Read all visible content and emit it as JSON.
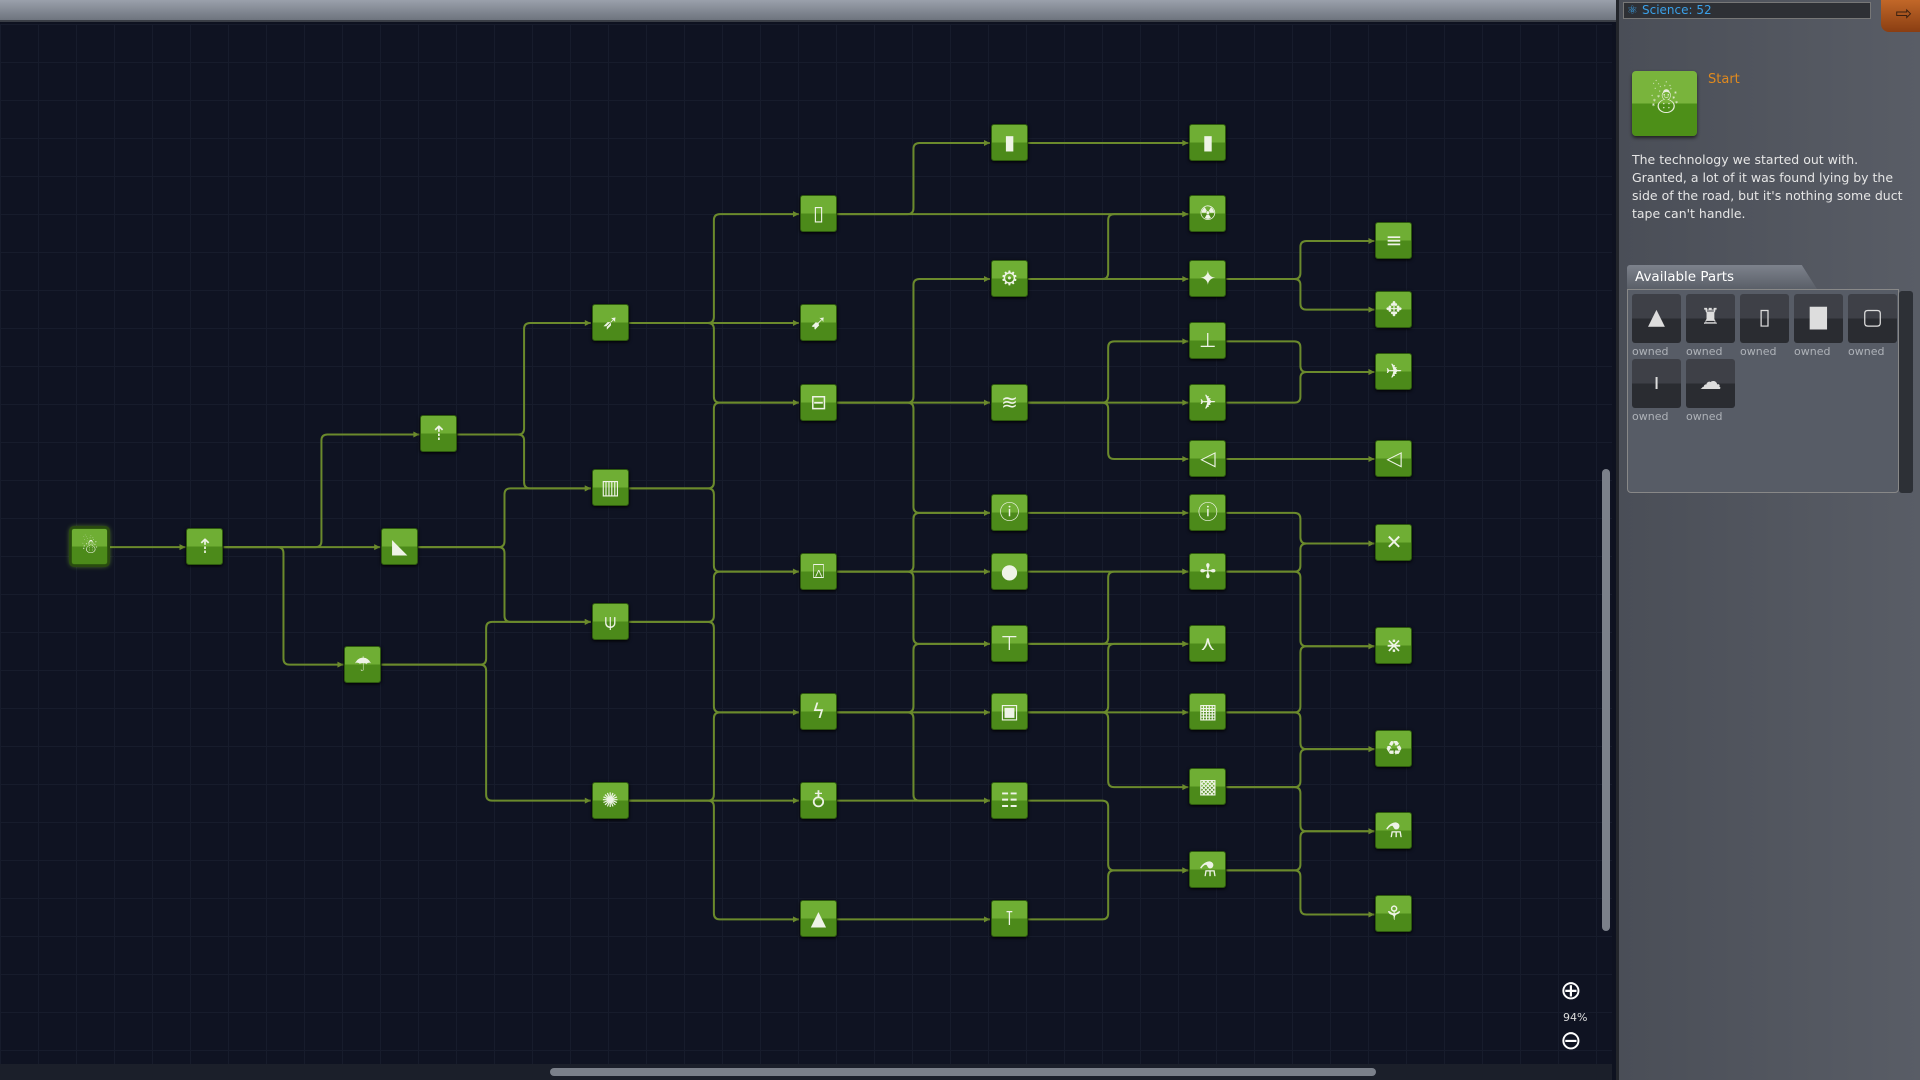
{
  "science": {
    "label": "Science: 52",
    "icon": "atom-icon"
  },
  "exit_button": {
    "icon": "exit-icon"
  },
  "selected_tech": {
    "title": "Start",
    "icon": "kerbal-icon",
    "description": "The technology we started out with. Granted, a lot of it was found lying by the side of the road, but it's nothing some duct tape can't handle."
  },
  "available_parts": {
    "tab_label": "Available Parts",
    "items": [
      {
        "icon": "command-pod-icon",
        "status": "owned"
      },
      {
        "icon": "liquid-engine-icon",
        "status": "owned"
      },
      {
        "icon": "fuel-tank-small-icon",
        "status": "owned"
      },
      {
        "icon": "fuel-tank-icon",
        "status": "owned"
      },
      {
        "icon": "truss-icon",
        "status": "owned"
      },
      {
        "icon": "solid-booster-icon",
        "status": "owned"
      },
      {
        "icon": "parachute-part-icon",
        "status": "owned"
      }
    ]
  },
  "zoom": {
    "level": "94%",
    "in_icon": "zoom-in-icon",
    "out_icon": "zoom-out-icon"
  },
  "colors": {
    "node": "#5c9c28",
    "edge": "#6b8a2c",
    "accent": "#e08a1e",
    "science": "#3aa0e8"
  },
  "nodes": [
    {
      "id": "start",
      "icon": "kerbal-icon",
      "selected": true
    },
    {
      "id": "n2",
      "icon": "rocket-icon"
    },
    {
      "id": "n3a",
      "icon": "rocket-icon"
    },
    {
      "id": "n3b",
      "icon": "wing-icon"
    },
    {
      "id": "n3c",
      "icon": "parachute-icon"
    },
    {
      "id": "n4a",
      "icon": "engine-icon"
    },
    {
      "id": "n4b",
      "icon": "tower-icon"
    },
    {
      "id": "n4c",
      "icon": "antenna-icon"
    },
    {
      "id": "n4d",
      "icon": "lightbulb-icon"
    },
    {
      "id": "n5a",
      "icon": "tank-icon"
    },
    {
      "id": "n5b",
      "icon": "jet-icon"
    },
    {
      "id": "n5c",
      "icon": "decoupler-icon"
    },
    {
      "id": "n5d",
      "icon": "dish-icon"
    },
    {
      "id": "n5e",
      "icon": "lightning-icon"
    },
    {
      "id": "n5f",
      "icon": "probe-icon"
    },
    {
      "id": "n5g",
      "icon": "lander-icon"
    },
    {
      "id": "n6a",
      "icon": "tanks-icon"
    },
    {
      "id": "n6b",
      "icon": "gear-icon"
    },
    {
      "id": "n6c",
      "icon": "aero-icon"
    },
    {
      "id": "n6d",
      "icon": "thermometer-icon"
    },
    {
      "id": "n6e",
      "icon": "bulb-icon"
    },
    {
      "id": "n6f",
      "icon": "drill-icon"
    },
    {
      "id": "n6g",
      "icon": "battery-icon"
    },
    {
      "id": "n6h",
      "icon": "ladder-icon"
    },
    {
      "id": "n6i",
      "icon": "wheel-icon"
    },
    {
      "id": "n7a",
      "icon": "large-tank-icon"
    },
    {
      "id": "n7b",
      "icon": "nuclear-icon"
    },
    {
      "id": "n7c",
      "icon": "ion-icon"
    },
    {
      "id": "n7d",
      "icon": "landing-gear-icon"
    },
    {
      "id": "n7e",
      "icon": "plane-icon"
    },
    {
      "id": "n7f",
      "icon": "intake-icon"
    },
    {
      "id": "n7g",
      "icon": "sensor-icon"
    },
    {
      "id": "n7h",
      "icon": "satellite-icon"
    },
    {
      "id": "n7i",
      "icon": "docking-icon"
    },
    {
      "id": "n7j",
      "icon": "solar-icon"
    },
    {
      "id": "n7k",
      "icon": "chip-icon"
    },
    {
      "id": "n7l",
      "icon": "science-icon"
    },
    {
      "id": "n8a",
      "icon": "stack-icon"
    },
    {
      "id": "n8b",
      "icon": "network-icon"
    },
    {
      "id": "n8c",
      "icon": "jet-plane-icon"
    },
    {
      "id": "n8d",
      "icon": "scoop-icon"
    },
    {
      "id": "n8e",
      "icon": "relay-icon"
    },
    {
      "id": "n8f",
      "icon": "array-icon"
    },
    {
      "id": "n8g",
      "icon": "recycle-icon"
    },
    {
      "id": "n8h",
      "icon": "lab-icon"
    },
    {
      "id": "n8i",
      "icon": "robot-arm-icon"
    }
  ],
  "edges": [
    [
      "start",
      "n2"
    ],
    [
      "n2",
      "n3a"
    ],
    [
      "n2",
      "n3b"
    ],
    [
      "n2",
      "n3c"
    ],
    [
      "n3a",
      "n4a"
    ],
    [
      "n3a",
      "n4b"
    ],
    [
      "n3b",
      "n4b"
    ],
    [
      "n3b",
      "n4c"
    ],
    [
      "n3c",
      "n4c"
    ],
    [
      "n3c",
      "n4d"
    ],
    [
      "n4a",
      "n5a"
    ],
    [
      "n4a",
      "n5b"
    ],
    [
      "n4a",
      "n5c"
    ],
    [
      "n4b",
      "n5c"
    ],
    [
      "n4b",
      "n5d"
    ],
    [
      "n4c",
      "n5d"
    ],
    [
      "n4c",
      "n5e"
    ],
    [
      "n4d",
      "n5e"
    ],
    [
      "n4d",
      "n5f"
    ],
    [
      "n4d",
      "n5g"
    ],
    [
      "n5a",
      "n6a"
    ],
    [
      "n5a",
      "n7b"
    ],
    [
      "n5c",
      "n6b"
    ],
    [
      "n5c",
      "n6c"
    ],
    [
      "n5c",
      "n6d"
    ],
    [
      "n5d",
      "n6d"
    ],
    [
      "n5d",
      "n6e"
    ],
    [
      "n5d",
      "n6f"
    ],
    [
      "n5e",
      "n6f"
    ],
    [
      "n5e",
      "n6g"
    ],
    [
      "n5e",
      "n6h"
    ],
    [
      "n5f",
      "n6h"
    ],
    [
      "n5g",
      "n6i"
    ],
    [
      "n6a",
      "n7a"
    ],
    [
      "n6b",
      "n7b"
    ],
    [
      "n6b",
      "n7c"
    ],
    [
      "n6c",
      "n7d"
    ],
    [
      "n6c",
      "n7e"
    ],
    [
      "n6c",
      "n7f"
    ],
    [
      "n6d",
      "n7g"
    ],
    [
      "n6e",
      "n7h"
    ],
    [
      "n6f",
      "n7h"
    ],
    [
      "n6f",
      "n7i"
    ],
    [
      "n6g",
      "n7i"
    ],
    [
      "n6g",
      "n7j"
    ],
    [
      "n6g",
      "n7k"
    ],
    [
      "n6h",
      "n7l"
    ],
    [
      "n6i",
      "n7l"
    ],
    [
      "n7c",
      "n8a"
    ],
    [
      "n7c",
      "n8b"
    ],
    [
      "n7d",
      "n8c"
    ],
    [
      "n7e",
      "n8c"
    ],
    [
      "n7f",
      "n8d"
    ],
    [
      "n7g",
      "n8e"
    ],
    [
      "n7h",
      "n8e"
    ],
    [
      "n7h",
      "n8f"
    ],
    [
      "n7j",
      "n8f"
    ],
    [
      "n7j",
      "n8g"
    ],
    [
      "n7k",
      "n8g"
    ],
    [
      "n7k",
      "n8h"
    ],
    [
      "n7l",
      "n8h"
    ],
    [
      "n7l",
      "n8i"
    ]
  ]
}
